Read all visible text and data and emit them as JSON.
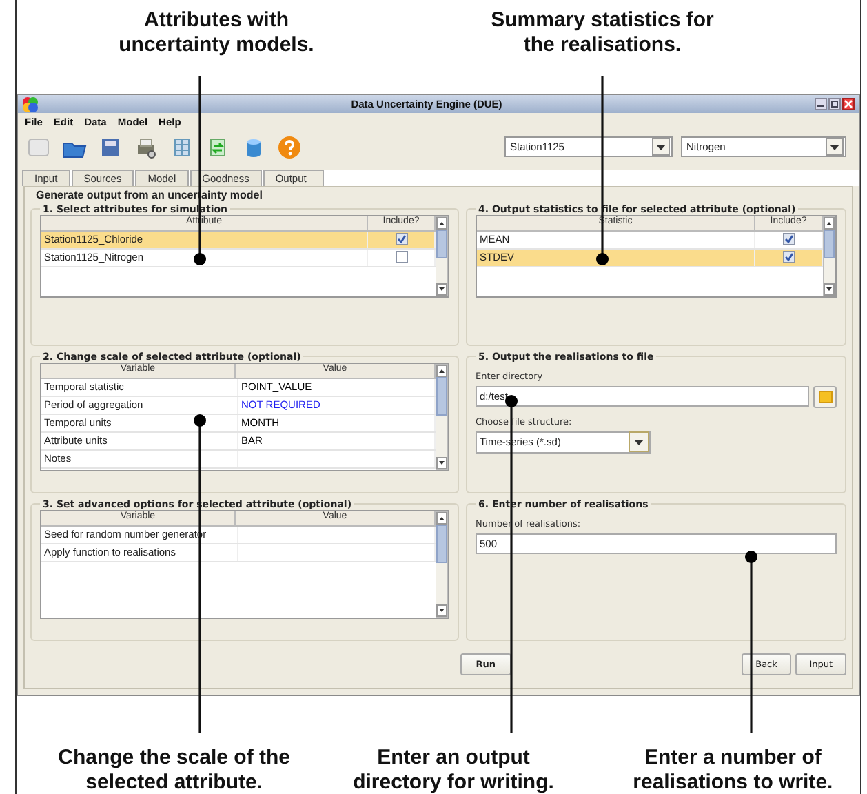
{
  "captions_top": [
    {
      "text": "Attributes with\nuncertainty models."
    },
    {
      "text": "Summary statistics for\nthe realisations."
    }
  ],
  "window": {
    "title": "Data Uncertainty Engine (DUE)"
  },
  "menu": [
    "File",
    "Edit",
    "Data",
    "Model",
    "Help"
  ],
  "selectors": [
    {
      "value": "Station1125"
    },
    {
      "value": "Nitrogen"
    }
  ],
  "tabs": [
    {
      "label": "Input",
      "selected": false
    },
    {
      "label": "Sources",
      "selected": false
    },
    {
      "label": "Model",
      "selected": false
    },
    {
      "label": "Goodness",
      "selected": false
    },
    {
      "label": "Output",
      "selected": true
    }
  ],
  "heading": "Generate output from an uncertainty model",
  "left_column": [
    {
      "kind": "checklist",
      "title": "1. Select attributes for simulation",
      "columns": [
        "Attribute",
        "Include?"
      ],
      "rows": [
        {
          "label": "Station1125_Chloride",
          "checked": true,
          "selected": true
        },
        {
          "label": "Station1125_Nitrogen",
          "checked": false,
          "selected": false
        }
      ]
    },
    {
      "kind": "properties",
      "title": "2. Change scale of selected attribute (optional)",
      "columns": [
        "Variable",
        "Value"
      ],
      "rows": [
        {
          "variable": "Temporal statistic",
          "value": "POINT_VALUE",
          "color": "#000000"
        },
        {
          "variable": "Period of aggregation",
          "value": "NOT REQUIRED",
          "color": "#1c1cf0"
        },
        {
          "variable": "Temporal units",
          "value": "MONTH",
          "color": "#000000"
        },
        {
          "variable": "Attribute units",
          "value": "BAR",
          "color": "#000000"
        },
        {
          "variable": "Notes"
        }
      ]
    },
    {
      "kind": "properties",
      "title": "3. Set advanced options for selected attribute (optional)",
      "columns": [
        "Variable",
        "Value"
      ],
      "rows": [
        {
          "variable": "Seed for random number generator"
        },
        {
          "variable": "Apply function to realisations"
        }
      ]
    }
  ],
  "right_column": [
    {
      "kind": "checklist",
      "title": "4. Output statistics to file for selected attribute (optional)",
      "columns": [
        "Statistic",
        "Include?"
      ],
      "rows": [
        {
          "label": "MEAN",
          "checked": true,
          "selected": false
        },
        {
          "label": "STDEV",
          "checked": true,
          "selected": true
        }
      ]
    },
    {
      "kind": "directory",
      "title": "5. Output the realisations to file",
      "directory_label": "Enter directory",
      "directory": "d:/test",
      "structure_label": "Choose file structure:",
      "structure": "Time-series (*.sd)"
    },
    {
      "kind": "count",
      "title": "6. Enter number of realisations",
      "label": "Number of realisations:",
      "value": "500"
    }
  ],
  "buttons": [
    {
      "label": "Run",
      "kind": "run"
    },
    {
      "label": "Back",
      "kind": "nav"
    },
    {
      "label": "Input",
      "kind": "nav"
    }
  ],
  "captions_bottom": [
    {
      "text": "Change the scale of the\nselected attribute."
    },
    {
      "text": "Enter an output\ndirectory for writing."
    },
    {
      "text": "Enter a number of\nrealisations to write."
    }
  ]
}
